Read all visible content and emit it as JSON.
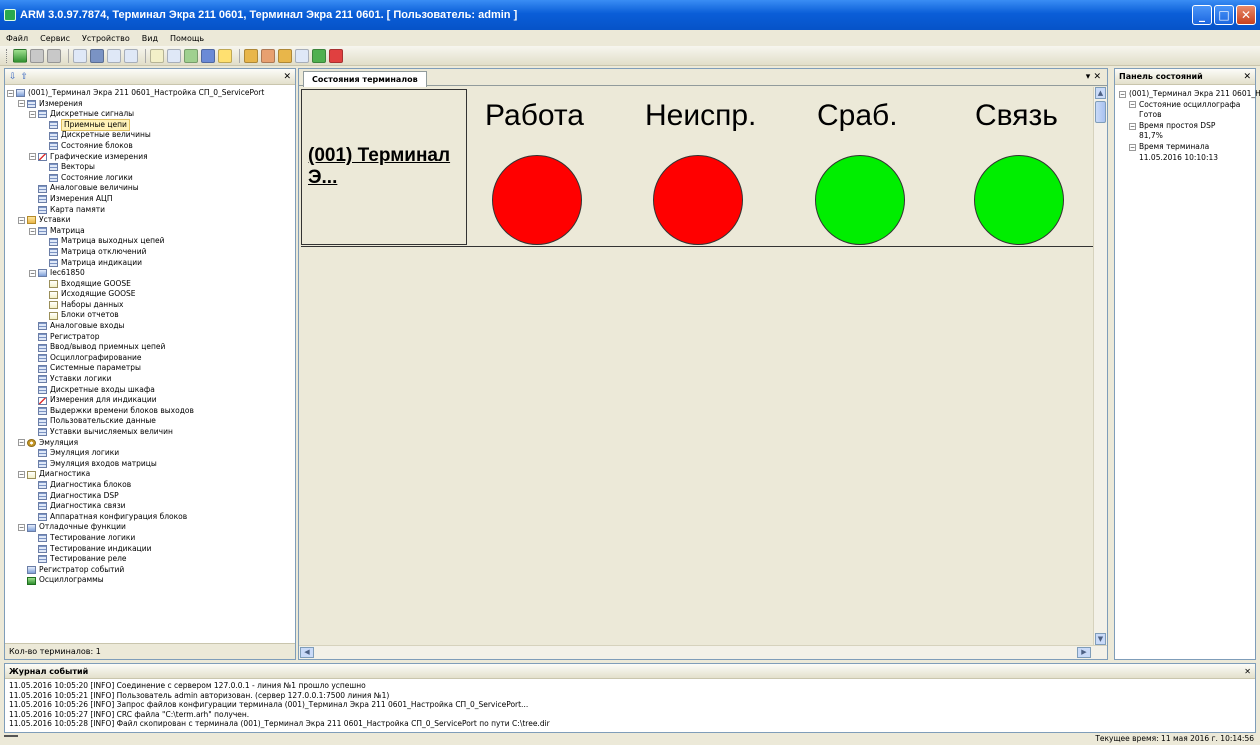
{
  "window": {
    "title": "ARM 3.0.97.7874, Терминал Экра 211 0601, Терминал Экра 211 0601. [ Пользователь: admin ]"
  },
  "menu": [
    "Файл",
    "Сервис",
    "Устройство",
    "Вид",
    "Помощь"
  ],
  "left_panel": {
    "items": [
      {
        "label": "(001)_Терминал Экра 211 0601_Настройка СП_0_ServicePort",
        "level": 0,
        "exp": "⊟",
        "icon": "pc"
      },
      {
        "label": "Измерения",
        "level": 1,
        "exp": "⊟",
        "icon": "grid"
      },
      {
        "label": "Дискретные сигналы",
        "level": 2,
        "exp": "⊟",
        "icon": "grid"
      },
      {
        "label": "Приемные цепи",
        "level": 3,
        "exp": "",
        "icon": "grid",
        "selected": true
      },
      {
        "label": "Дискретные величины",
        "level": 3,
        "exp": "",
        "icon": "grid"
      },
      {
        "label": "Состояние блоков",
        "level": 3,
        "exp": "",
        "icon": "grid"
      },
      {
        "label": "Графические измерения",
        "level": 2,
        "exp": "⊟",
        "icon": "chart"
      },
      {
        "label": "Векторы",
        "level": 3,
        "exp": "",
        "icon": "grid"
      },
      {
        "label": "Состояние логики",
        "level": 3,
        "exp": "",
        "icon": "grid"
      },
      {
        "label": "Аналоговые величины",
        "level": 2,
        "exp": "",
        "icon": "grid"
      },
      {
        "label": "Измерения АЦП",
        "level": 2,
        "exp": "",
        "icon": "grid"
      },
      {
        "label": "Карта памяти",
        "level": 2,
        "exp": "",
        "icon": "grid"
      },
      {
        "label": "Уставки",
        "level": 1,
        "exp": "⊟",
        "icon": "folder"
      },
      {
        "label": "Матрица",
        "level": 2,
        "exp": "⊟",
        "icon": "grid"
      },
      {
        "label": "Матрица выходных цепей",
        "level": 3,
        "exp": "",
        "icon": "grid"
      },
      {
        "label": "Матрица отключений",
        "level": 3,
        "exp": "",
        "icon": "grid"
      },
      {
        "label": "Матрица индикации",
        "level": 3,
        "exp": "",
        "icon": "grid"
      },
      {
        "label": "Iec61850",
        "level": 2,
        "exp": "⊟",
        "icon": "pc"
      },
      {
        "label": "Входящие GOOSE",
        "level": 3,
        "exp": "",
        "icon": "doc"
      },
      {
        "label": "Исходящие GOOSE",
        "level": 3,
        "exp": "",
        "icon": "doc"
      },
      {
        "label": "Наборы данных",
        "level": 3,
        "exp": "",
        "icon": "doc"
      },
      {
        "label": "Блоки отчетов",
        "level": 3,
        "exp": "",
        "icon": "doc"
      },
      {
        "label": "Аналоговые входы",
        "level": 2,
        "exp": "",
        "icon": "grid"
      },
      {
        "label": "Регистратор",
        "level": 2,
        "exp": "",
        "icon": "grid"
      },
      {
        "label": "Ввод/вывод приемных цепей",
        "level": 2,
        "exp": "",
        "icon": "grid"
      },
      {
        "label": "Осциллографирование",
        "level": 2,
        "exp": "",
        "icon": "grid"
      },
      {
        "label": "Системные параметры",
        "level": 2,
        "exp": "",
        "icon": "grid"
      },
      {
        "label": "Уставки логики",
        "level": 2,
        "exp": "",
        "icon": "grid"
      },
      {
        "label": "Дискретные входы шкафа",
        "level": 2,
        "exp": "",
        "icon": "grid"
      },
      {
        "label": "Измерения для индикации",
        "level": 2,
        "exp": "",
        "icon": "chart"
      },
      {
        "label": "Выдержки времени блоков выходов",
        "level": 2,
        "exp": "",
        "icon": "grid"
      },
      {
        "label": "Пользовательские данные",
        "level": 2,
        "exp": "",
        "icon": "grid"
      },
      {
        "label": "Уставки вычисляемых величин",
        "level": 2,
        "exp": "",
        "icon": "grid"
      },
      {
        "label": "Эмуляция",
        "level": 1,
        "exp": "⊟",
        "icon": "gear"
      },
      {
        "label": "Эмуляция логики",
        "level": 2,
        "exp": "",
        "icon": "grid"
      },
      {
        "label": "Эмуляция входов матрицы",
        "level": 2,
        "exp": "",
        "icon": "grid"
      },
      {
        "label": "Диагностика",
        "level": 1,
        "exp": "⊟",
        "icon": "doc"
      },
      {
        "label": "Диагностика блоков",
        "level": 2,
        "exp": "",
        "icon": "grid"
      },
      {
        "label": "Диагностика DSP",
        "level": 2,
        "exp": "",
        "icon": "grid"
      },
      {
        "label": "Диагностика связи",
        "level": 2,
        "exp": "",
        "icon": "grid"
      },
      {
        "label": "Аппаратная конфигурация блоков",
        "level": 2,
        "exp": "",
        "icon": "grid"
      },
      {
        "label": "Отладочные функции",
        "level": 1,
        "exp": "⊟",
        "icon": "pc"
      },
      {
        "label": "Тестирование логики",
        "level": 2,
        "exp": "",
        "icon": "grid"
      },
      {
        "label": "Тестирование индикации",
        "level": 2,
        "exp": "",
        "icon": "grid"
      },
      {
        "label": "Тестирование реле",
        "level": 2,
        "exp": "",
        "icon": "grid"
      },
      {
        "label": "Регистратор событий",
        "level": 1,
        "exp": "",
        "icon": "pc"
      },
      {
        "label": "Осциллограммы",
        "level": 1,
        "exp": "",
        "icon": "green"
      }
    ],
    "footer": "Кол-во терминалов: 1"
  },
  "center": {
    "tab_label": "Состояния терминалов",
    "terminal_name": "(001) Терминал Э...",
    "statuses": [
      {
        "label": "Работа",
        "color": "#ff0000"
      },
      {
        "label": "Неиспр.",
        "color": "#ff0000"
      },
      {
        "label": "Сраб.",
        "color": "#00ee00"
      },
      {
        "label": "Связь",
        "color": "#00ee00"
      }
    ]
  },
  "right_panel": {
    "title": "Панель состояний",
    "items": [
      {
        "label": "(001)_Терминал Экра 211 0601_H",
        "level": 0,
        "exp": "⊟"
      },
      {
        "label": "Состояние осциллографа",
        "level": 1,
        "exp": "⊟"
      },
      {
        "label": "Готов",
        "level": 2,
        "exp": ""
      },
      {
        "label": "Время простоя DSP",
        "level": 1,
        "exp": "⊟"
      },
      {
        "label": "81,7%",
        "level": 2,
        "exp": ""
      },
      {
        "label": "Время терминала",
        "level": 1,
        "exp": "⊟"
      },
      {
        "label": "11.05.2016 10:10:13",
        "level": 2,
        "exp": ""
      }
    ]
  },
  "journal": {
    "title": "Журнал событий",
    "lines": [
      "11.05.2016 10:05:20 [INFO] Соединение с сервером 127.0.0.1 - линия №1 прошло успешно",
      "11.05.2016 10:05:21 [INFO] Пользователь admin авторизован. (сервер 127.0.0.1:7500 линия №1)",
      "11.05.2016 10:05:26 [INFO] Запрос файлов конфигурации терминала (001)_Терминал Экра 211 0601_Настройка СП_0_ServicePort...",
      "11.05.2016 10:05:27 [INFO] CRC файла \"C:\\term.arh\" получен.",
      "11.05.2016 10:05:28 [INFO] Файл скопирован с терминала (001)_Терминал Экра 211 0601_Настройка СП_0_ServicePort по пути C:\\tree.dir"
    ]
  },
  "statusbar": {
    "time": "Текущее время: 11 мая 2016 г. 10:14:56"
  }
}
